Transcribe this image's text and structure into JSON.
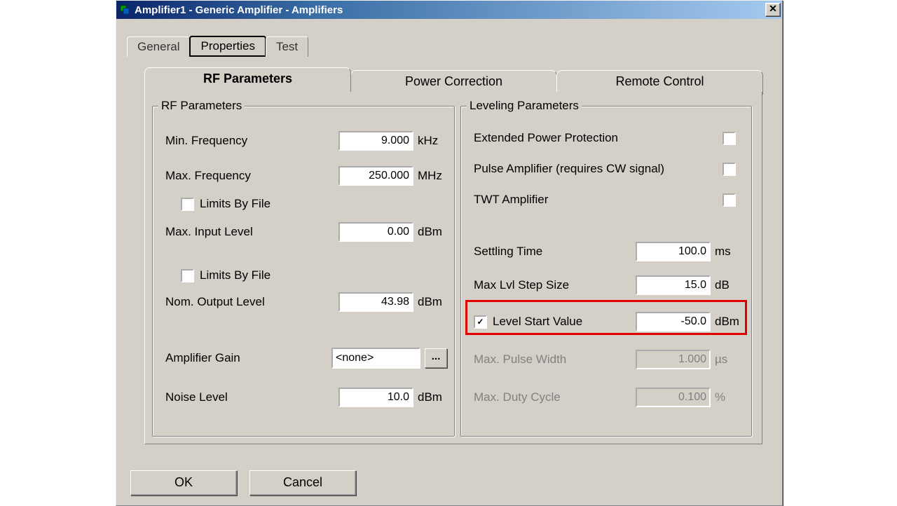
{
  "title": "Amplifier1 - Generic Amplifier - Amplifiers",
  "top_tabs": {
    "general": "General",
    "properties": "Properties",
    "test": "Test"
  },
  "inner_tabs": {
    "rf": "RF Parameters",
    "pc": "Power Correction",
    "rc": "Remote Control"
  },
  "rf_group_title": "RF Parameters",
  "lvl_group_title": "Leveling Parameters",
  "rf": {
    "min_freq_label": "Min. Frequency",
    "min_freq_value": "9.000",
    "min_freq_unit": "kHz",
    "max_freq_label": "Max. Frequency",
    "max_freq_value": "250.000",
    "max_freq_unit": "MHz",
    "limits_by_file_1": "Limits By File",
    "max_input_label": "Max. Input Level",
    "max_input_value": "0.00",
    "max_input_unit": "dBm",
    "limits_by_file_2": "Limits By File",
    "nom_output_label": "Nom. Output Level",
    "nom_output_value": "43.98",
    "nom_output_unit": "dBm",
    "amp_gain_label": "Amplifier Gain",
    "amp_gain_value": "<none>",
    "dots": "...",
    "noise_label": "Noise Level",
    "noise_value": "10.0",
    "noise_unit": "dBm"
  },
  "lvl": {
    "ext_power": "Extended Power Protection",
    "pulse_amp": "Pulse Amplifier (requires CW signal)",
    "twt_amp": "TWT Amplifier",
    "settling_label": "Settling Time",
    "settling_value": "100.0",
    "settling_unit": "ms",
    "step_label": "Max Lvl Step Size",
    "step_value": "15.0",
    "step_unit": "dB",
    "start_label": "Level Start Value",
    "start_value": "-50.0",
    "start_unit": "dBm",
    "pulse_width_label": "Max. Pulse Width",
    "pulse_width_value": "1.000",
    "pulse_width_unit": "µs",
    "duty_label": "Max. Duty Cycle",
    "duty_value": "0.100",
    "duty_unit": "%"
  },
  "footer": {
    "ok": "OK",
    "cancel": "Cancel"
  }
}
